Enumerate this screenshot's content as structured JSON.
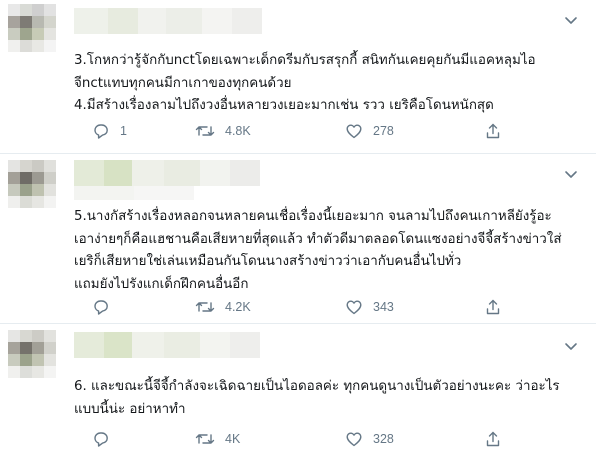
{
  "icons": {
    "reply": "reply-icon",
    "retweet": "retweet-icon",
    "like": "like-icon",
    "share": "share-icon",
    "caret": "chevron-down-icon"
  },
  "colors": {
    "icon": "#657786",
    "text": "#14171a",
    "divider": "#e6ecf0"
  },
  "tweets": [
    {
      "lines": [
        "3.โกหกว่ารู้จักกับnctโดยเฉพาะเด็กดรีมกับรสรุกกี้ สนิทกันเคยคุยกันมีแอคหลุมไอ",
        "จีnctแทบทุกคนมีกาเกาของทุกคนด้วย",
        "4.มีสร้างเรื่องลามไปถึงวงอื่นหลายวงเยอะมากเช่น รวว เยริคือโดนหนักสุด"
      ],
      "reply_count": "1",
      "retweet_count": "4.8K",
      "like_count": "278"
    },
    {
      "lines": [
        "5.นางกัสร้างเรื่องหลอกจนหลายคนเชื่อเรื่องนี้เยอะมาก จนลามไปถึงคนเกาหลียังรู้อะ",
        "เอาง่ายๆก็คือแฮชานคือเสียหายที่สุดแล้ว ทำตัวดีมาตลอดโดนแซงอย่างจีจี้สร้างข่าวใส่",
        "เยริก็เสียหายใช่เล่นเหมือนกันโดนนางสร้างข่าวว่าเอากับคนอื่นไปทั่ว",
        "แถมยังไปรังแกเด็กฝึกคนอื่นอีก"
      ],
      "reply_count": "",
      "retweet_count": "4.2K",
      "like_count": "343"
    },
    {
      "lines": [
        "6. และขณะนี้จีจี้กำลังจะเฉิดฉายเป็นไอดอลค่ะ ทุกคนดูนางเป็นตัวอย่างนะคะ ว่าอะไร",
        "แบบนี้น่ะ อย่าหาทำ"
      ],
      "reply_count": "",
      "retweet_count": "4K",
      "like_count": "328"
    }
  ]
}
